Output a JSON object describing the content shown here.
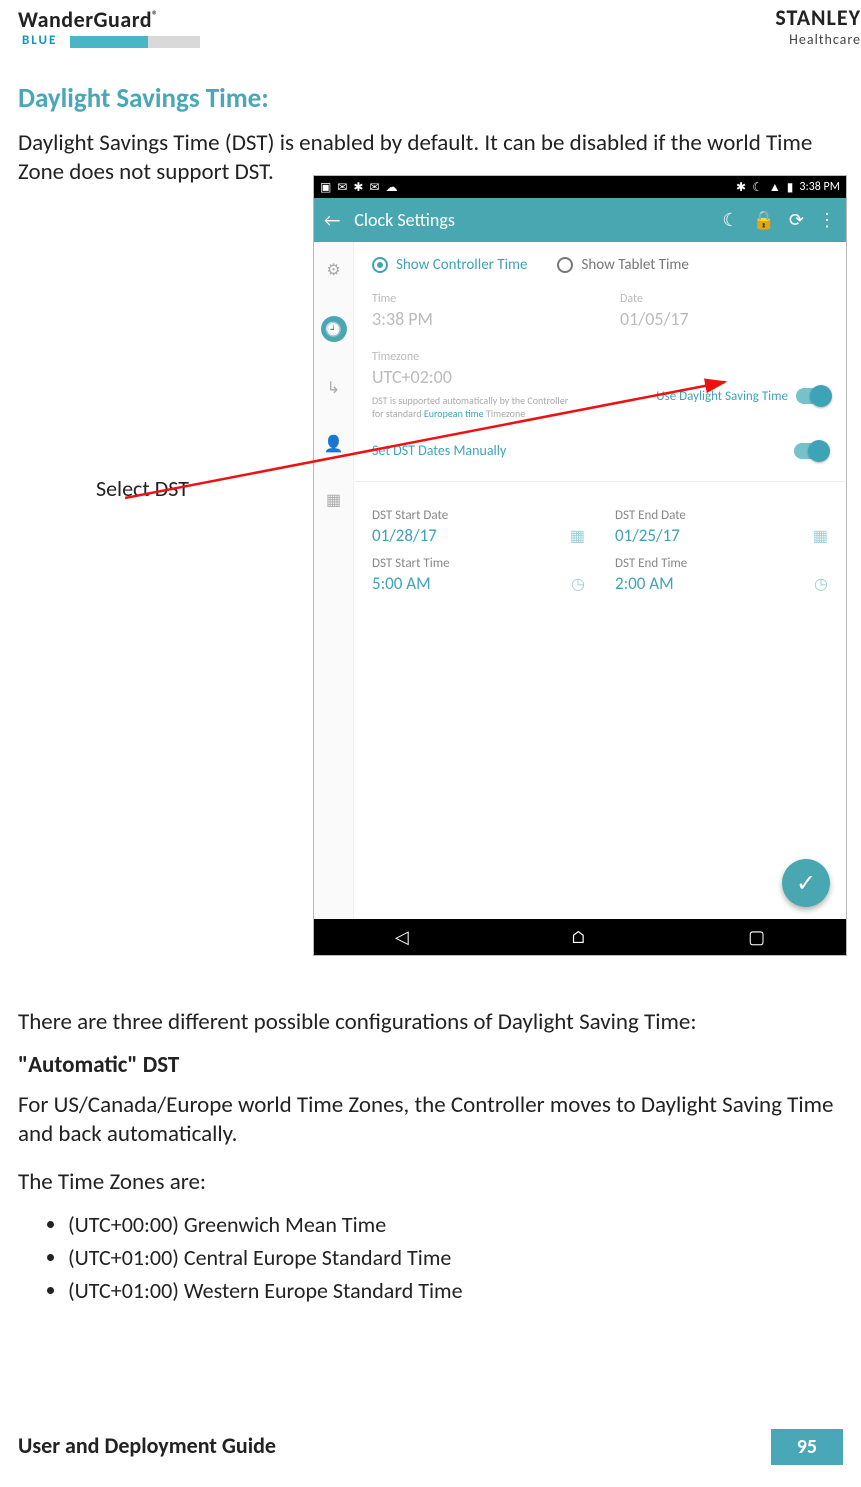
{
  "brand": {
    "wanderguard": "WanderGuard",
    "reg": "®",
    "blue": "BLUE",
    "stanley": "STANLEY",
    "healthcare": "Healthcare"
  },
  "section_title": "Daylight Savings Time:",
  "intro": "Daylight Savings Time (DST) is enabled by default. It can be disabled if the world Time Zone does not support DST.",
  "annotation": "Select DST",
  "after_shot_intro": "There are three different possible configurations of Daylight Saving Time:",
  "auto_dst_heading": "\"Automatic\" DST",
  "auto_dst_body": "For US/Canada/Europe world Time Zones, the Controller moves to Daylight Saving Time and back automatically.",
  "tz_intro": "The Time Zones are:",
  "tz_list": [
    "(UTC+00:00) Greenwich Mean Time",
    "(UTC+01:00) Central Europe Standard Time",
    "(UTC+01:00) Western Europe Standard Time"
  ],
  "footer": {
    "title": "User and Deployment Guide",
    "page": "95"
  },
  "shot": {
    "status_time": "3:38 PM",
    "appbar_title": "Clock Settings",
    "radios": {
      "controller": "Show Controller Time",
      "tablet": "Show Tablet Time"
    },
    "time_label": "Time",
    "time_value": "3:38 PM",
    "date_label": "Date",
    "date_value": "01/05/17",
    "tz_label": "Timezone",
    "tz_value": "UTC+02:00",
    "dst_note_pre": "DST is supported automatically by the Controller for standard ",
    "dst_note_link": "European time",
    "dst_note_post": " Timezone",
    "use_dst": "Use Daylight Saving Time",
    "set_manually": "Set DST Dates Manually",
    "start_date_label": "DST Start Date",
    "start_date": "01/28/17",
    "end_date_label": "DST End Date",
    "end_date": "01/25/17",
    "start_time_label": "DST Start Time",
    "start_time": "5:00 AM",
    "end_time_label": "DST End Time",
    "end_time": "2:00 AM"
  }
}
